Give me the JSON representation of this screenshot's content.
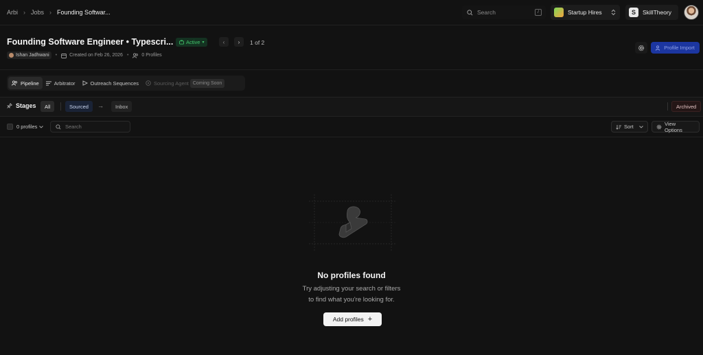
{
  "breadcrumb": [
    "Arbi",
    "Jobs",
    "Founding Softwar..."
  ],
  "top_search": {
    "placeholder": "Search",
    "shortcut": "/"
  },
  "org": {
    "name": "Startup Hires"
  },
  "workspace": {
    "name": "SkillTheory",
    "logo_letter": "S"
  },
  "job": {
    "title": "Founding Software Engineer • Typescri...",
    "status": "Active",
    "counter": "1 of 2",
    "owner": "Ishan Jadhwani",
    "created": "Created on Feb 26, 2026",
    "profiles": "0 Profiles"
  },
  "actions": {
    "profile_import": "Profile Import"
  },
  "tabs": [
    {
      "label": "Pipeline",
      "active": true
    },
    {
      "label": "Arbitrator"
    },
    {
      "label": "Outreach Sequences"
    },
    {
      "label": "Sourcing Agent",
      "disabled": true,
      "badge": "Coming Soon"
    }
  ],
  "stages": {
    "label": "Stages",
    "all": "All",
    "sourced": "Sourced",
    "arrow": "→",
    "inbox": "Inbox",
    "archived": "Archived"
  },
  "toolbar": {
    "profiles_count": "0 profiles",
    "search_placeholder": "Search",
    "sort": "Sort",
    "view_options": "View Options"
  },
  "empty": {
    "title": "No profiles found",
    "line1": "Try adjusting your search or filters",
    "line2": "to find what you're looking for.",
    "button": "Add profiles",
    "button_icon": "+"
  },
  "colors": {
    "background": "#121212",
    "active_green": "#43c56c",
    "primary_blue": "#1c36a0"
  }
}
